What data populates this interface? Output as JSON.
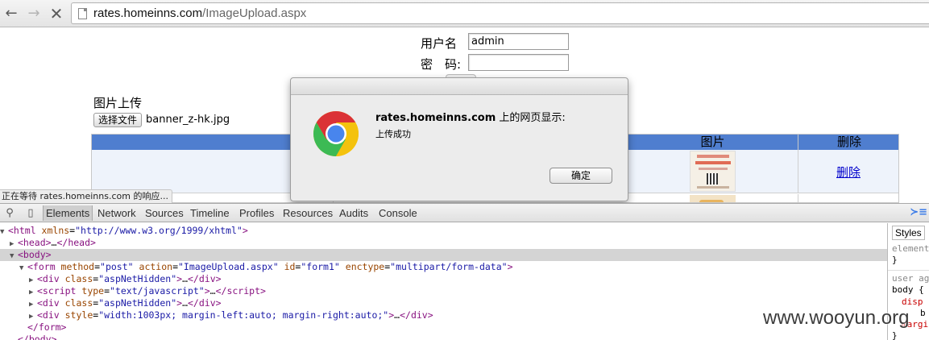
{
  "browser": {
    "url_host": "rates.homeinns.com",
    "url_path": "/ImageUpload.aspx",
    "status_text": "正在等待 rates.homeinns.com 的响应..."
  },
  "login": {
    "username_label": "用户名",
    "username_value": "admin",
    "password_label": "密　码:",
    "password_value": ""
  },
  "upload": {
    "title": "图片上传",
    "choose_file_label": "选择文件",
    "file_name": "banner_z-hk.jpg"
  },
  "grid": {
    "headers": {
      "image": "图片",
      "delete": "删除"
    },
    "rows": [
      {
        "delete_label": "删除"
      }
    ]
  },
  "dialog": {
    "title_host": "rates.homeinns.com",
    "title_suffix": " 上的网页显示:",
    "message": "上传成功",
    "ok_label": "确定"
  },
  "devtools": {
    "tabs": [
      "Elements",
      "Network",
      "Sources",
      "Timeline",
      "Profiles",
      "Resources",
      "Audits",
      "Console"
    ],
    "active_tab": "Elements",
    "dom": [
      {
        "tri": "▼",
        "html": "html_open"
      },
      {
        "tri": "▶",
        "html": "head"
      },
      {
        "tri": "▼",
        "html": "body"
      },
      {
        "tri": "▼",
        "html": "form"
      },
      {
        "tri": "▶",
        "html": "div1"
      },
      {
        "tri": "▶",
        "html": "script"
      },
      {
        "tri": "▶",
        "html": "div2"
      },
      {
        "tri": "▶",
        "html": "div3"
      },
      {
        "tri": "",
        "html": "form_close"
      },
      {
        "tri": "",
        "html": "body_close"
      }
    ],
    "dom_text": {
      "html_open": {
        "tag": "html",
        "attr": "xmlns",
        "val": "\"http://www.w3.org/1999/xhtml\""
      },
      "head": "…",
      "form": {
        "method": "\"post\"",
        "action": "\"ImageUpload.aspx\"",
        "id": "\"form1\"",
        "enctype": "\"multipart/form-data\""
      },
      "div1_class": "\"aspNetHidden\"",
      "script_type": "\"text/javascript\"",
      "div2_class": "\"aspNetHidden\"",
      "div3_style": "\"width:1003px; margin-left:auto; margin-right:auto;\""
    },
    "styles_tab": "Styles",
    "styles_lines": [
      "element",
      "}",
      "user ag",
      "body {",
      "disp",
      "b",
      "margi",
      "}"
    ]
  },
  "watermark": "www.wooyun.org"
}
